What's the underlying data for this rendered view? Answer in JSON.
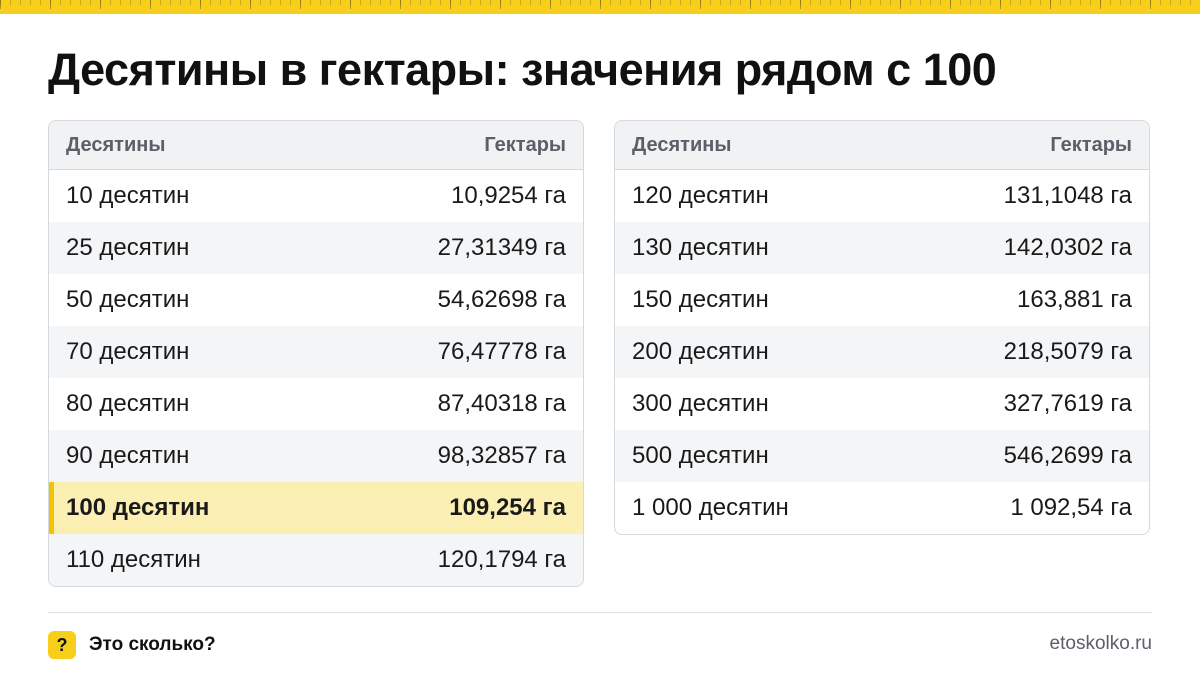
{
  "title": "Десятины в гектары: значения рядом с 100",
  "left_table": {
    "headers": [
      "Десятины",
      "Гектары"
    ],
    "rows": [
      [
        "10 десятин",
        "10,9254 га"
      ],
      [
        "25 десятин",
        "27,31349 га"
      ],
      [
        "50 десятин",
        "54,62698 га"
      ],
      [
        "70 десятин",
        "76,47778 га"
      ],
      [
        "80 десятин",
        "87,40318 га"
      ],
      [
        "90 десятин",
        "98,32857 га"
      ],
      [
        "100 десятин",
        "109,254 га"
      ],
      [
        "110 десятин",
        "120,1794 га"
      ]
    ],
    "highlighted_row": 6
  },
  "right_table": {
    "headers": [
      "Десятины",
      "Гектары"
    ],
    "rows": [
      [
        "120 десятин",
        "131,1048 га"
      ],
      [
        "130 десятин",
        "142,0302 га"
      ],
      [
        "150 десятин",
        "163,881 га"
      ],
      [
        "200 десятин",
        "218,5079 га"
      ],
      [
        "300 десятин",
        "327,7619 га"
      ],
      [
        "500 десятин",
        "546,2699 га"
      ],
      [
        "1 000 десятин",
        "1 092,54 га"
      ]
    ]
  },
  "footer": {
    "icon_glyph": "?",
    "brand": "Это сколько?",
    "site": "etoskolko.ru"
  },
  "colors": {
    "accent": "#f7cf1a",
    "highlight_bg": "#fcefb4",
    "highlight_bar": "#f2c400",
    "header_bg": "#f1f2f4",
    "muted_text": "#5b6068"
  }
}
